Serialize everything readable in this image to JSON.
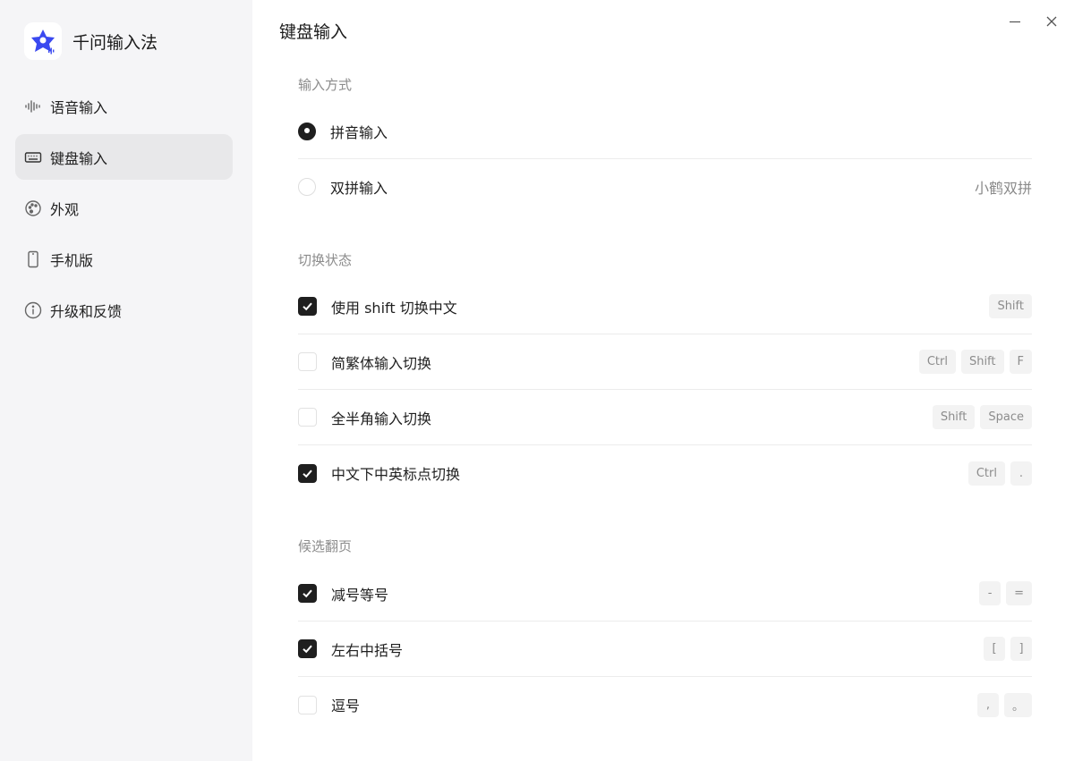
{
  "brand": {
    "name": "千问输入法"
  },
  "sidebar": {
    "items": [
      {
        "label": "语音输入",
        "icon": "waveform-icon"
      },
      {
        "label": "键盘输入",
        "icon": "keyboard-icon",
        "active": true
      },
      {
        "label": "外观",
        "icon": "palette-icon"
      },
      {
        "label": "手机版",
        "icon": "phone-icon"
      },
      {
        "label": "升级和反馈",
        "icon": "info-icon"
      }
    ]
  },
  "page": {
    "title": "键盘输入"
  },
  "sections": {
    "input_method": {
      "title": "输入方式",
      "options": [
        {
          "label": "拼音输入",
          "selected": true
        },
        {
          "label": "双拼输入",
          "selected": false,
          "value": "小鹤双拼"
        }
      ]
    },
    "switch_state": {
      "title": "切换状态",
      "items": [
        {
          "label": "使用 shift 切换中文",
          "checked": true,
          "keys": [
            "Shift"
          ]
        },
        {
          "label": "简繁体输入切换",
          "checked": false,
          "keys": [
            "Ctrl",
            "Shift",
            "F"
          ]
        },
        {
          "label": "全半角输入切换",
          "checked": false,
          "keys": [
            "Shift",
            "Space"
          ]
        },
        {
          "label": "中文下中英标点切换",
          "checked": true,
          "keys": [
            "Ctrl",
            "."
          ]
        }
      ]
    },
    "paging": {
      "title": "候选翻页",
      "items": [
        {
          "label": "减号等号",
          "checked": true,
          "keys": [
            "-",
            "="
          ]
        },
        {
          "label": "左右中括号",
          "checked": true,
          "keys": [
            "[",
            "]"
          ]
        },
        {
          "label": "逗号",
          "checked": false,
          "keys": [
            ",",
            "。"
          ]
        }
      ]
    }
  },
  "colors": {
    "accent": "#1f1f1f",
    "sidebar_bg": "#f5f5f7",
    "active_bg": "#e8e8ea",
    "logo_blue": "#3a49f0"
  }
}
